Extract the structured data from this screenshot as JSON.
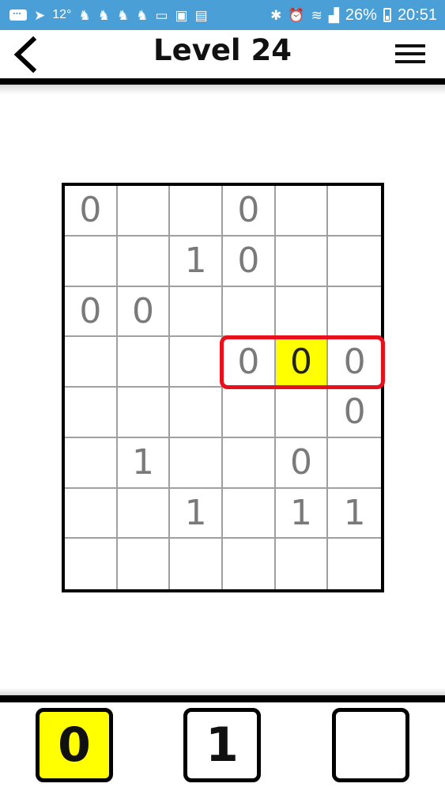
{
  "status_bar": {
    "temperature": "12°",
    "battery": "26%",
    "time": "20:51"
  },
  "header": {
    "title": "Level 24"
  },
  "board": {
    "rows": 8,
    "cols": 6,
    "cells": [
      [
        "0",
        "",
        "",
        "0",
        "",
        ""
      ],
      [
        "",
        "",
        "1",
        "0",
        "",
        ""
      ],
      [
        "0",
        "0",
        "",
        "",
        "",
        ""
      ],
      [
        "",
        "",
        "",
        "0",
        "0",
        "0"
      ],
      [
        "",
        "",
        "",
        "",
        "",
        "0"
      ],
      [
        "",
        "1",
        "",
        "",
        "0",
        ""
      ],
      [
        "",
        "",
        "1",
        "",
        "1",
        "1"
      ],
      [
        "",
        "",
        "",
        "",
        "",
        ""
      ]
    ],
    "selected_cell": {
      "row": 3,
      "col": 4
    },
    "highlight_row": 3,
    "highlight_cols": [
      3,
      5
    ],
    "selected_color": "#ffff00",
    "highlight_color": "#e8101c"
  },
  "keypad": {
    "keys": [
      "0",
      "1",
      ""
    ],
    "active_key": "0"
  }
}
